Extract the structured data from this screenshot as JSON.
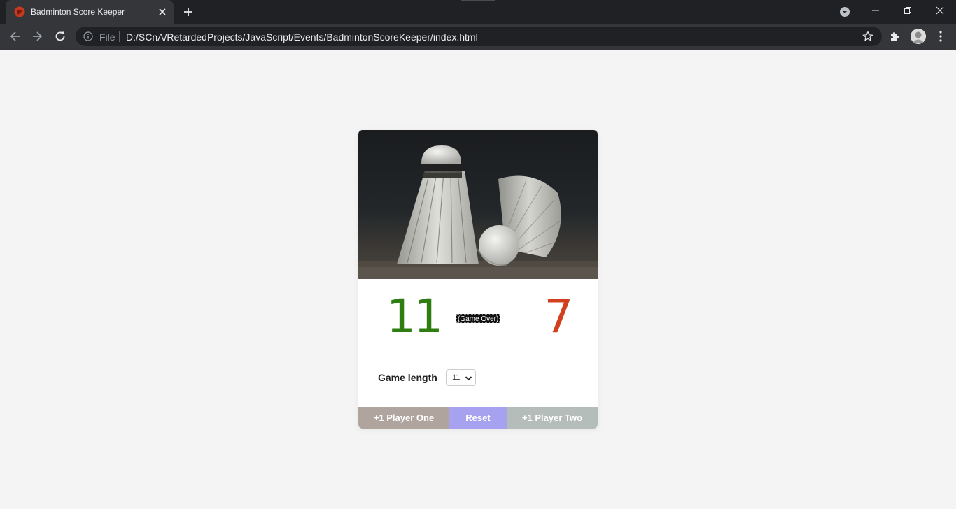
{
  "browser": {
    "tab_title": "Badminton Score Keeper",
    "omnibox_scheme": "File",
    "url": "D:/SCnA/RetardedProjects/JavaScript/Events/BadmintonScoreKeeper/index.html"
  },
  "scoreboard": {
    "player_one_score": "11",
    "player_two_score": "7",
    "status": "(Game Over)",
    "player_one_color": "#2e7d0f",
    "player_two_color": "#d2401f"
  },
  "game_length": {
    "label": "Game length",
    "selected": "11"
  },
  "buttons": {
    "player_one": "+1 Player One",
    "reset": "Reset",
    "player_two": "+1 Player Two"
  },
  "image": {
    "subject": "badminton-shuttlecocks-photo"
  }
}
